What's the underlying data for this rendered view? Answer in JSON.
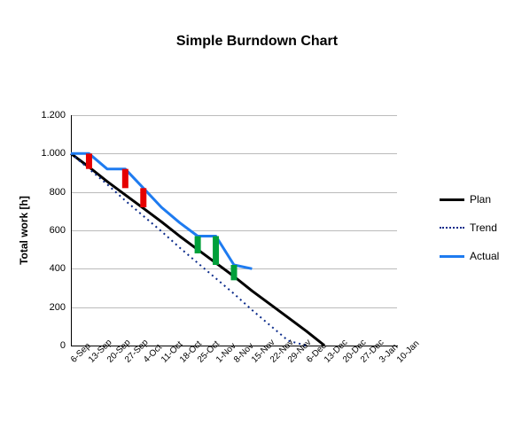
{
  "chart_data": {
    "type": "line",
    "title": "Simple Burndown Chart",
    "xlabel": "",
    "ylabel": "Total work [h]",
    "ylim": [
      0,
      1200
    ],
    "yticks": [
      0,
      200,
      400,
      600,
      800,
      1000,
      1200
    ],
    "ytick_labels": [
      "0",
      "200",
      "400",
      "600",
      "800",
      "1.000",
      "1.200"
    ],
    "categories": [
      "6-Sep",
      "13-Sep",
      "20-Sep",
      "27-Sep",
      "4-Oct",
      "11-Oct",
      "18-Oct",
      "25-Oct",
      "1-Nov",
      "8-Nov",
      "15-Nov",
      "22-Nov",
      "29-Nov",
      "6-Dec",
      "13-Dec",
      "20-Dec",
      "27-Dec",
      "3-Jan",
      "10-Jan"
    ],
    "series": [
      {
        "name": "Plan",
        "color": "#000000",
        "style": "solid",
        "width": 3,
        "values": [
          1000,
          930,
          855,
          785,
          715,
          645,
          570,
          500,
          430,
          360,
          285,
          215,
          145,
          75,
          0,
          null,
          null,
          null,
          null
        ]
      },
      {
        "name": "Trend",
        "color": "#0a2a8a",
        "style": "dotted",
        "width": 2,
        "values": [
          1000,
          920,
          840,
          755,
          675,
          595,
          510,
          430,
          350,
          270,
          185,
          105,
          25,
          0,
          null,
          null,
          null,
          null,
          null
        ]
      },
      {
        "name": "Actual",
        "color": "#1e7bf0",
        "style": "solid",
        "width": 3,
        "values": [
          1000,
          1000,
          920,
          920,
          820,
          720,
          640,
          570,
          570,
          420,
          400,
          null,
          null,
          null,
          null,
          null,
          null,
          null,
          null
        ]
      }
    ],
    "drops": [
      {
        "i": 1,
        "from": 1000,
        "to": 920,
        "color": "#e60000"
      },
      {
        "i": 3,
        "from": 920,
        "to": 820,
        "color": "#e60000"
      },
      {
        "i": 4,
        "from": 820,
        "to": 720,
        "color": "#e60000"
      },
      {
        "i": 7,
        "from": 570,
        "to": 480,
        "color": "#00a03a"
      },
      {
        "i": 8,
        "from": 570,
        "to": 420,
        "color": "#00a03a"
      },
      {
        "i": 9,
        "from": 420,
        "to": 340,
        "color": "#00a03a"
      }
    ],
    "legend_position": "right"
  },
  "legend": {
    "plan": "Plan",
    "trend": "Trend",
    "actual": "Actual"
  },
  "colors": {
    "plan": "#000000",
    "trend": "#0a2a8a",
    "actual": "#1e7bf0",
    "drop_red": "#e60000",
    "drop_green": "#00a03a"
  }
}
